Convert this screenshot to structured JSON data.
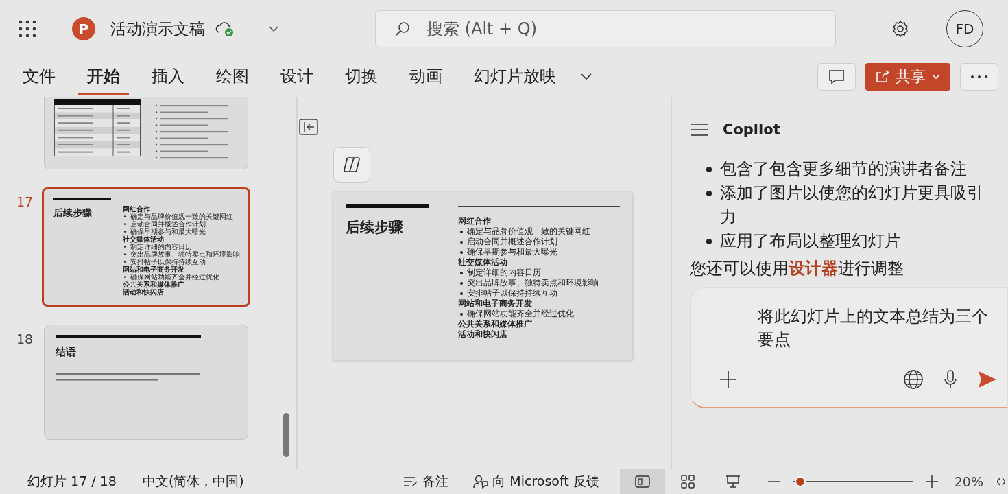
{
  "app_bar": {
    "logo_letter": "P",
    "title": "活动演示文稿",
    "search": {
      "placeholder": "搜索 (Alt + Q)"
    },
    "avatar": "FD"
  },
  "ribbon_tabs": [
    {
      "label": "文件",
      "selected": false
    },
    {
      "label": "开始",
      "selected": true
    },
    {
      "label": "插入",
      "selected": false
    },
    {
      "label": "绘图",
      "selected": false
    },
    {
      "label": "设计",
      "selected": false
    },
    {
      "label": "切换",
      "selected": false
    },
    {
      "label": "动画",
      "selected": false
    },
    {
      "label": "幻灯片放映",
      "selected": false
    }
  ],
  "share_button": "共享",
  "thumbnails": [
    {
      "kind": "table",
      "selected": false
    },
    {
      "kind": "text",
      "number": "17",
      "selected": true,
      "title": "后续步骤",
      "lines": [
        {
          "kind": "heading",
          "text": "网红合作"
        },
        {
          "kind": "bullet",
          "text": "确定与品牌价值观一致的关键网红"
        },
        {
          "kind": "bullet",
          "text": "启动合同并概述合作计划"
        },
        {
          "kind": "bullet",
          "text": "确保早期参与和最大曝光"
        },
        {
          "kind": "heading",
          "text": "社交媒体活动"
        },
        {
          "kind": "bullet",
          "text": "制定详细的内容日历"
        },
        {
          "kind": "bullet",
          "text": "突出品牌故事、独特卖点和环境影响"
        },
        {
          "kind": "bullet",
          "text": "安排帖子以保持持续互动"
        },
        {
          "kind": "heading",
          "text": "网站和电子商务开发"
        },
        {
          "kind": "bullet",
          "text": "确保网站功能齐全并经过优化"
        },
        {
          "kind": "heading",
          "text": "公共关系和媒体推广"
        },
        {
          "kind": "heading",
          "text": "活动和快闪店"
        }
      ]
    },
    {
      "kind": "closing",
      "number": "18",
      "selected": false,
      "title": "结语"
    }
  ],
  "slide": {
    "title": "后续步骤",
    "lines": [
      {
        "kind": "heading",
        "text": "网红合作"
      },
      {
        "kind": "bullet",
        "text": "确定与品牌价值观一致的关键网红"
      },
      {
        "kind": "bullet",
        "text": "启动合同并概述合作计划"
      },
      {
        "kind": "bullet",
        "text": "确保早期参与和最大曝光"
      },
      {
        "kind": "heading",
        "text": "社交媒体活动"
      },
      {
        "kind": "bullet",
        "text": "制定详细的内容日历"
      },
      {
        "kind": "bullet",
        "text": "突出品牌故事、独特卖点和环境影响"
      },
      {
        "kind": "bullet",
        "text": "安排帖子以保持持续互动"
      },
      {
        "kind": "heading",
        "text": "网站和电子商务开发"
      },
      {
        "kind": "bullet",
        "text": "确保网站功能齐全并经过优化"
      },
      {
        "kind": "heading",
        "text": "公共关系和媒体推广"
      },
      {
        "kind": "heading",
        "text": "活动和快闪店"
      }
    ]
  },
  "copilot": {
    "title": "Copilot",
    "bullets": [
      "包含了包含更多细节的演讲者备注",
      "添加了图片以使您的幻灯片更具吸引力",
      "应用了布局以整理幻灯片"
    ],
    "note": "您还可以使用**设计器**进行调整",
    "prompt": "将此幻灯片上的文本总结为三个要点"
  },
  "status_bar": {
    "slide": "幻灯片 17 / 18",
    "language": "中文(简体，中国)",
    "notes": "备注",
    "feedback": "向 Microsoft 反馈",
    "zoom_slider": {
      "level": 0.02
    },
    "zoom": "20%"
  }
}
